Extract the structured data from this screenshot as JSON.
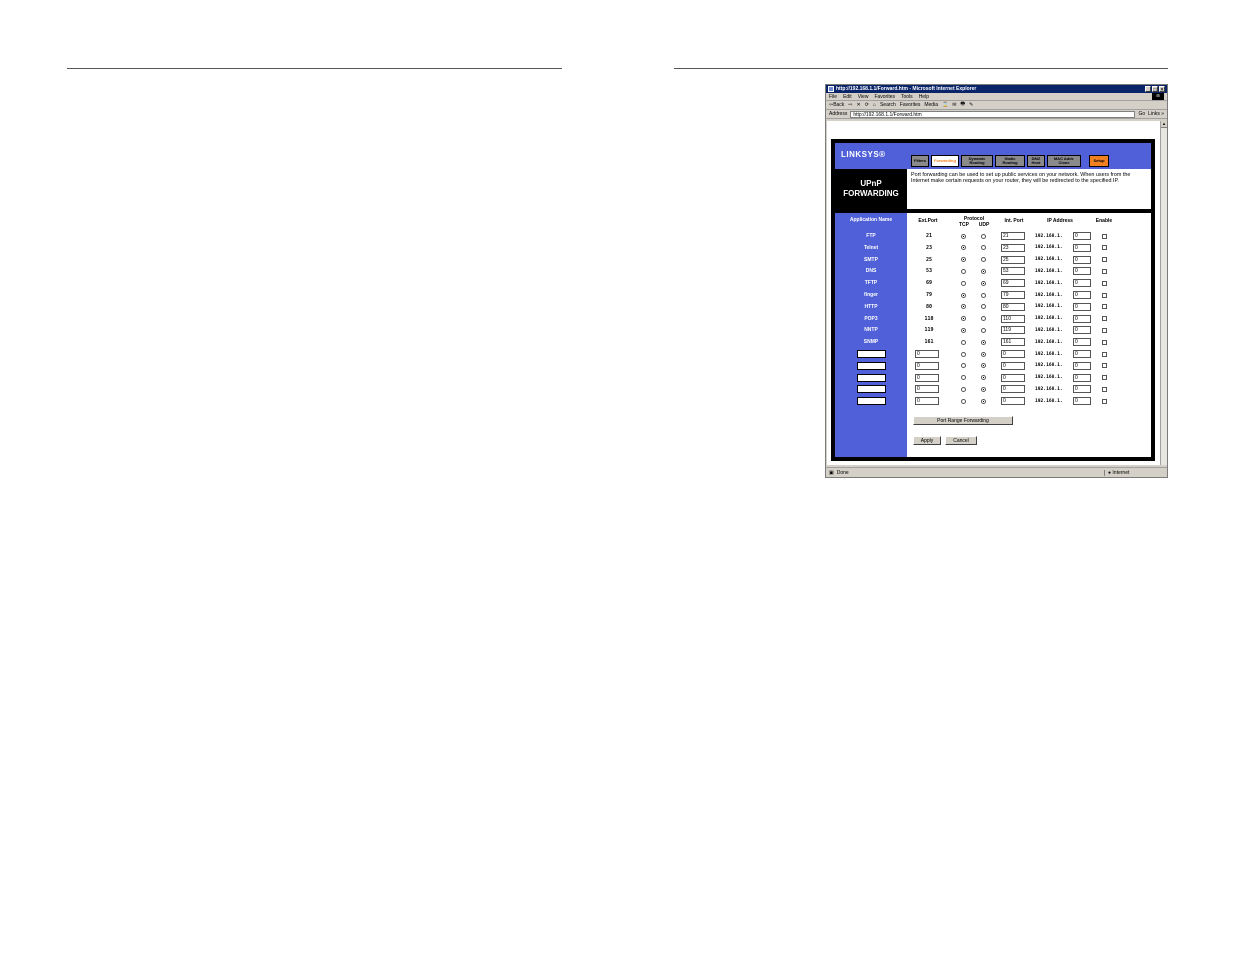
{
  "browser": {
    "title": "http://192.168.1.1/Forward.htm - Microsoft Internet Explorer",
    "menu": [
      "File",
      "Edit",
      "View",
      "Favorites",
      "Tools",
      "Help"
    ],
    "toolbar": [
      "⇦Back",
      "⇨",
      "✕",
      "⟳",
      "⌂",
      "Search",
      "Favorites",
      "Media",
      "⌛",
      "✉",
      "🖶",
      "✎"
    ],
    "address_label": "Address",
    "address": "http://192.168.1.1/Forward.htm",
    "go_label": "Go",
    "links_label": "Links »",
    "status_text": "Done",
    "status_zone": "Internet"
  },
  "router": {
    "logo": "LINKSYS®",
    "tabs": [
      {
        "label": "Filters"
      },
      {
        "label": "Forwarding"
      },
      {
        "label": "Dynamic Routing"
      },
      {
        "label": "Static Routing"
      },
      {
        "label": "DMZ Host"
      },
      {
        "label": "MAC Addr. Clone"
      },
      {
        "label": "Setup"
      }
    ],
    "section_line1": "UPnP",
    "section_line2": "FORWARDING",
    "description": "Port forwarding can be used to set up public services on your network. When users from the Internet make certain requests on your router, they will be redirected to the specified IP.",
    "headers": {
      "app_name": "Application Name",
      "ext_port": "Ext.Port",
      "protocol": "Protocol",
      "tcp": "TCP",
      "udp": "UDP",
      "int_port": "Int. Port",
      "ip": "IP Address",
      "enable": "Enable"
    },
    "rows": [
      {
        "app": "FTP",
        "ext": "21",
        "proto": "TCP",
        "int": "21",
        "ip_prefix": "192.168.1.",
        "ip_last": "0"
      },
      {
        "app": "Telnet",
        "ext": "23",
        "proto": "TCP",
        "int": "23",
        "ip_prefix": "192.168.1.",
        "ip_last": "0"
      },
      {
        "app": "SMTP",
        "ext": "25",
        "proto": "TCP",
        "int": "25",
        "ip_prefix": "192.168.1.",
        "ip_last": "0"
      },
      {
        "app": "DNS",
        "ext": "53",
        "proto": "UDP",
        "int": "53",
        "ip_prefix": "192.168.1.",
        "ip_last": "0"
      },
      {
        "app": "TFTP",
        "ext": "69",
        "proto": "UDP",
        "int": "69",
        "ip_prefix": "192.168.1.",
        "ip_last": "0"
      },
      {
        "app": "finger",
        "ext": "79",
        "proto": "TCP",
        "int": "79",
        "ip_prefix": "192.168.1.",
        "ip_last": "0"
      },
      {
        "app": "HTTP",
        "ext": "80",
        "proto": "TCP",
        "int": "80",
        "ip_prefix": "192.168.1.",
        "ip_last": "0"
      },
      {
        "app": "POP3",
        "ext": "110",
        "proto": "TCP",
        "int": "110",
        "ip_prefix": "192.168.1.",
        "ip_last": "0"
      },
      {
        "app": "NNTP",
        "ext": "119",
        "proto": "TCP",
        "int": "119",
        "ip_prefix": "192.168.1.",
        "ip_last": "0"
      },
      {
        "app": "SNMP",
        "ext": "161",
        "proto": "UDP",
        "int": "161",
        "ip_prefix": "192.168.1.",
        "ip_last": "0"
      }
    ],
    "custom_rows": [
      {
        "ext": "0",
        "proto": "UDP",
        "int": "0",
        "ip_prefix": "192.168.1.",
        "ip_last": "0"
      },
      {
        "ext": "0",
        "proto": "UDP",
        "int": "0",
        "ip_prefix": "192.168.1.",
        "ip_last": "0"
      },
      {
        "ext": "0",
        "proto": "UDP",
        "int": "0",
        "ip_prefix": "192.168.1.",
        "ip_last": "0"
      },
      {
        "ext": "0",
        "proto": "UDP",
        "int": "0",
        "ip_prefix": "192.168.1.",
        "ip_last": "0"
      },
      {
        "ext": "0",
        "proto": "UDP",
        "int": "0",
        "ip_prefix": "192.168.1.",
        "ip_last": "0"
      }
    ],
    "port_range_button": "Port Range Forwarding",
    "apply_button": "Apply",
    "cancel_button": "Cancel"
  }
}
